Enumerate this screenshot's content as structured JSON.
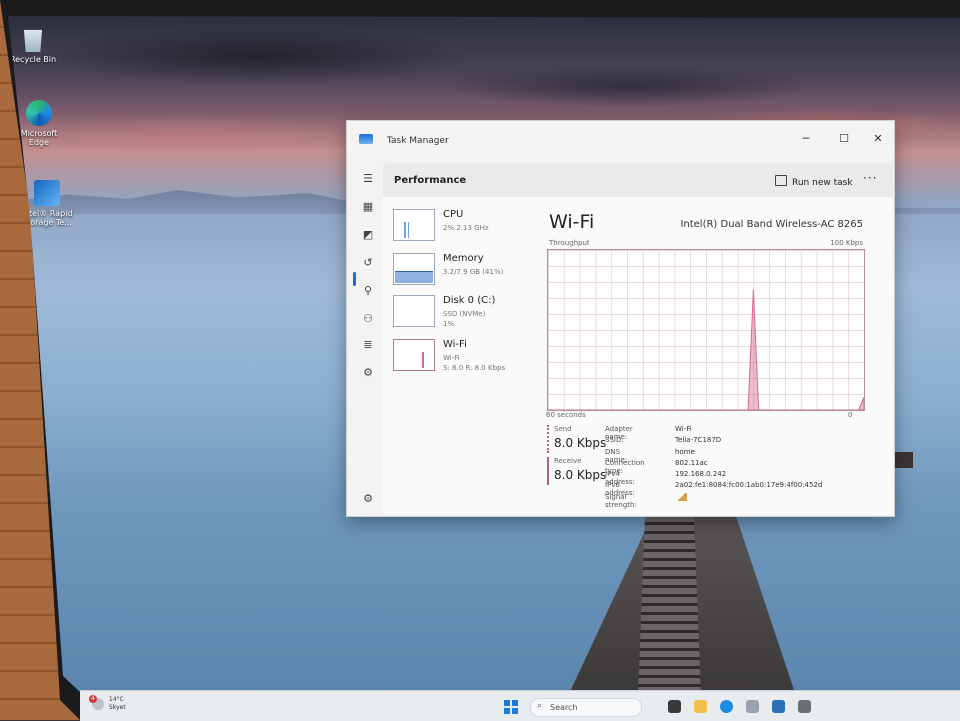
{
  "desktop": {
    "icons": [
      {
        "label": "Recycle Bin"
      },
      {
        "label": "Microsoft Edge"
      },
      {
        "label": "Intel® Rapid Storage Te..."
      }
    ]
  },
  "task_manager": {
    "title": "Task Manager",
    "window_controls": {
      "minimize": "─",
      "maximize": "☐",
      "close": "✕"
    },
    "section_title": "Performance",
    "run_new_task_label": "Run new task",
    "more_label": "···",
    "resources": [
      {
        "name": "CPU",
        "sub": "2% 2.13 GHz"
      },
      {
        "name": "Memory",
        "sub": "3.2/7.9 GB (41%)"
      },
      {
        "name": "Disk 0 (C:)",
        "sub": "SSD (NVMe)",
        "sub2": "1%"
      },
      {
        "name": "Wi-Fi",
        "sub": "Wi-Fi",
        "sub2": "S: 8.0 R: 8.0 Kbps"
      }
    ],
    "detail": {
      "title": "Wi-Fi",
      "adapter": "Intel(R) Dual Band Wireless-AC 8265",
      "throughput_label": "Throughput",
      "max_label": "100 Kbps",
      "x_left_label": "60 seconds",
      "x_right_label": "0",
      "send": {
        "label": "Send",
        "value": "8.0 Kbps"
      },
      "receive": {
        "label": "Receive",
        "value": "8.0 Kbps"
      },
      "properties": [
        {
          "key": "Adapter name:",
          "value": "Wi-Fi"
        },
        {
          "key": "SSID:",
          "value": "Telia-7C187D"
        },
        {
          "key": "DNS name:",
          "value": "home"
        },
        {
          "key": "Connection type:",
          "value": "802.11ac"
        },
        {
          "key": "IPv4 address:",
          "value": "192.168.0.242"
        },
        {
          "key": "IPv6 address:",
          "value": "2a02:fe1:8084:fc00:1ab0:17e9:4f00:452d"
        },
        {
          "key": "Signal strength:",
          "value": ""
        }
      ],
      "graph_series": [
        {
          "seconds_ago": 60,
          "kbps": 0
        },
        {
          "seconds_ago": 22,
          "kbps": 0
        },
        {
          "seconds_ago": 21,
          "kbps": 75
        },
        {
          "seconds_ago": 20,
          "kbps": 0
        },
        {
          "seconds_ago": 1,
          "kbps": 0
        },
        {
          "seconds_ago": 0,
          "kbps": 8
        }
      ]
    }
  },
  "taskbar": {
    "weather": {
      "temp": "14°C",
      "condition": "Skyet",
      "badge": "4"
    },
    "search_placeholder": "Search",
    "search_icon": "search-icon"
  },
  "colors": {
    "accent": "#1a6fd1",
    "wifi_graph": "#d46a8b",
    "wifi_graph_border": "#b98a9c"
  }
}
